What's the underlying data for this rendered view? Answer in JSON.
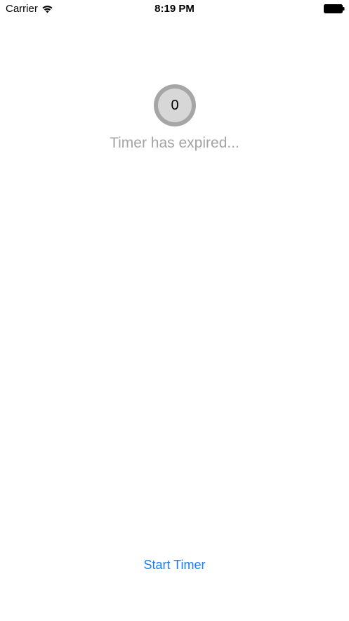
{
  "status_bar": {
    "carrier": "Carrier",
    "time": "8:19 PM",
    "wifi_icon": "wifi-icon",
    "battery_icon": "battery-full-icon"
  },
  "timer": {
    "count": "0",
    "message": "Timer has expired..."
  },
  "actions": {
    "start_label": "Start Timer"
  },
  "colors": {
    "accent": "#1a7ef2",
    "ring": "#a6a6a6",
    "ring_fill": "#d7d7d7",
    "message": "#a3a3a3"
  }
}
